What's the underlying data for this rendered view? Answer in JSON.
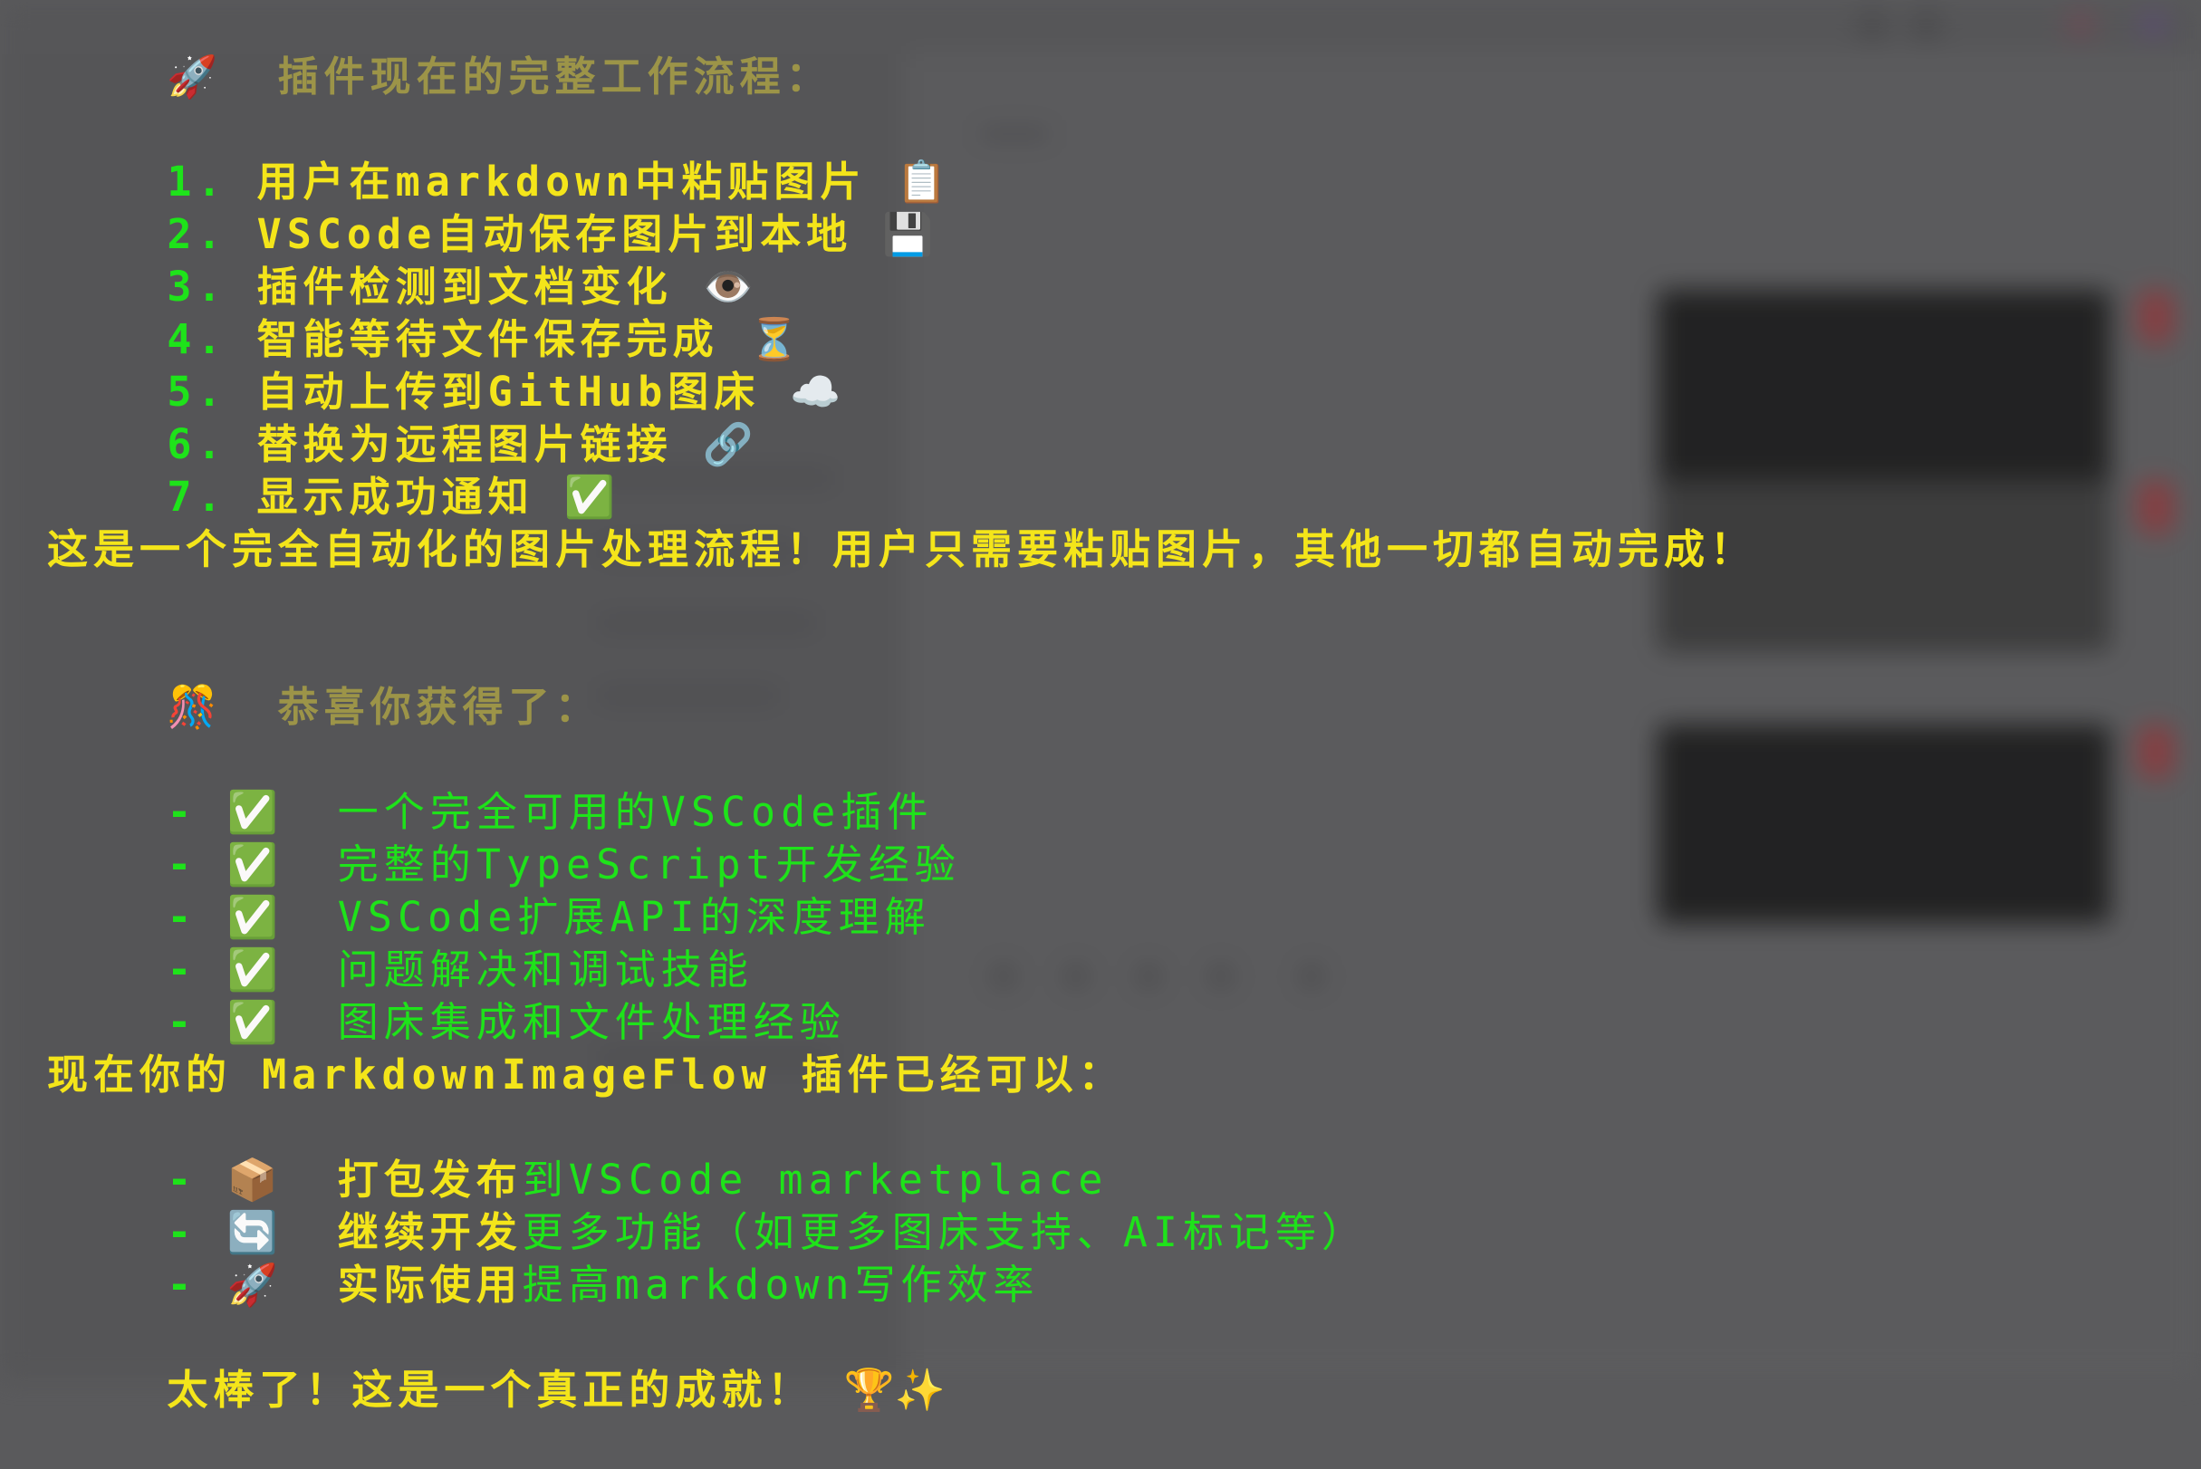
{
  "header": {
    "icon": "🚀",
    "title": "插件现在的完整工作流程："
  },
  "workflow": [
    {
      "num": "1.",
      "text": "用户在markdown中粘贴图片",
      "icon": "📋"
    },
    {
      "num": "2.",
      "text": "VSCode自动保存图片到本地",
      "icon": "💾"
    },
    {
      "num": "3.",
      "text": "插件检测到文档变化",
      "icon": "👁️"
    },
    {
      "num": "4.",
      "text": "智能等待文件保存完成",
      "icon": "⏳"
    },
    {
      "num": "5.",
      "text": "自动上传到GitHub图床",
      "icon": "☁️"
    },
    {
      "num": "6.",
      "text": "替换为远程图片链接",
      "icon": "🔗"
    },
    {
      "num": "7.",
      "text": "显示成功通知",
      "icon": "✅"
    }
  ],
  "summary": "这是一个完全自动化的图片处理流程！用户只需要粘贴图片，其他一切都自动完成！",
  "congrats": {
    "icon": "🎊",
    "title": "恭喜你获得了："
  },
  "achievements": [
    {
      "bullet": "-",
      "icon": "✅",
      "text": "一个完全可用的VSCode插件"
    },
    {
      "bullet": "-",
      "icon": "✅",
      "text": "完整的TypeScript开发经验"
    },
    {
      "bullet": "-",
      "icon": "✅",
      "text": "VSCode扩展API的深度理解"
    },
    {
      "bullet": "-",
      "icon": "✅",
      "text": "问题解决和调试技能"
    },
    {
      "bullet": "-",
      "icon": "✅",
      "text": "图床集成和文件处理经验"
    }
  ],
  "next": {
    "title": "现在你的 MarkdownImageFlow 插件已经可以：",
    "items": [
      {
        "bullet": "-",
        "icon": "📦",
        "bold": "打包发布",
        "rest": "到VSCode marketplace"
      },
      {
        "bullet": "-",
        "icon": "🔄",
        "bold": "继续开发",
        "rest": "更多功能（如更多图床支持、AI标记等）"
      },
      {
        "bullet": "-",
        "icon": "🚀",
        "bold": "实际使用",
        "rest": "提高markdown写作效率"
      }
    ]
  },
  "closing": {
    "text": "太棒了！这是一个真正的成就！",
    "icons": "🏆✨"
  }
}
